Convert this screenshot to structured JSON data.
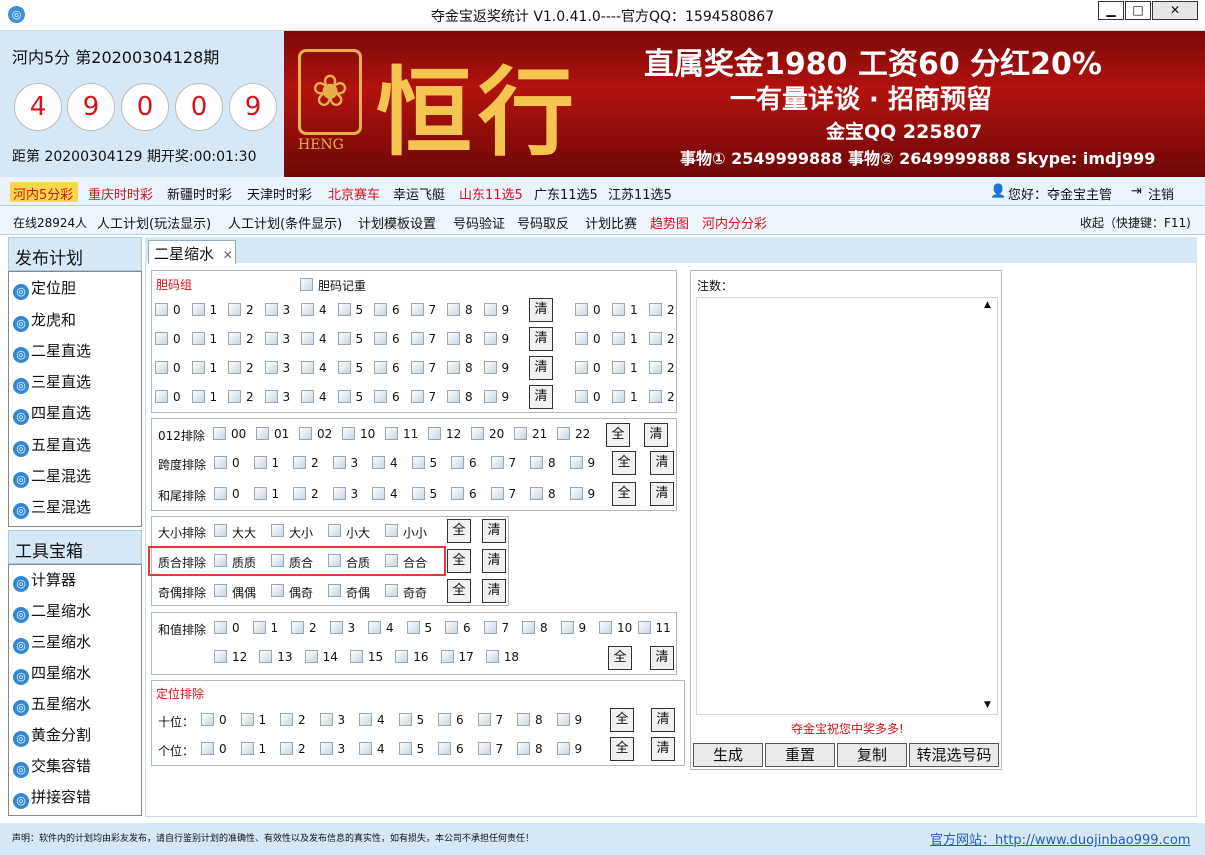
{
  "window": {
    "title": "夺金宝返奖统计  V1.0.41.0----官方QQ：1594580867"
  },
  "header": {
    "lottery_name": "河内5分  第20200304128期",
    "balls": [
      "4",
      "9",
      "0",
      "0",
      "9"
    ],
    "countdown": "距第 20200304129 期开奖:00:01:30"
  },
  "banner": {
    "logo_text": "HENG",
    "big_text": "恒行",
    "line1": "直属奖金1980 工资60 分红20%",
    "line2": "一有量详谈 · 招商预留",
    "line3": "金宝QQ 225807",
    "line4": "事物① 2549999888  事物② 2649999888  Skype: imdj999"
  },
  "lottery_nav": {
    "items": [
      {
        "label": "河内5分彩",
        "color": "#d8111a"
      },
      {
        "label": "重庆时时彩",
        "color": "#d8111a"
      },
      {
        "label": "新疆时时彩",
        "color": "#111111"
      },
      {
        "label": "天津时时彩",
        "color": "#111111"
      },
      {
        "label": "北京赛车",
        "color": "#d8111a"
      },
      {
        "label": "幸运飞艇",
        "color": "#111111"
      },
      {
        "label": "山东11选5",
        "color": "#d8111a"
      },
      {
        "label": "广东11选5",
        "color": "#111111"
      },
      {
        "label": "江苏11选5",
        "color": "#111111"
      }
    ],
    "user_greeting": "您好：夺金宝主管",
    "logout": "注销"
  },
  "tool_nav": {
    "online": "在线28924人",
    "items": [
      {
        "label": "人工计划(玩法显示)",
        "color": "#111111"
      },
      {
        "label": "人工计划(条件显示)",
        "color": "#111111"
      },
      {
        "label": "计划模板设置",
        "color": "#111111"
      },
      {
        "label": "号码验证",
        "color": "#111111"
      },
      {
        "label": "号码取反",
        "color": "#111111"
      },
      {
        "label": "计划比赛",
        "color": "#111111"
      },
      {
        "label": "趋势图",
        "color": "#d8111a"
      },
      {
        "label": "河内分分彩",
        "color": "#d8111a"
      }
    ],
    "collapse": "收起（快捷键：F11)"
  },
  "left_panel": {
    "group1_title": "发布计划",
    "group1_items": [
      "定位胆",
      "龙虎和",
      "二星直选",
      "三星直选",
      "四星直选",
      "五星直选",
      "二星混选",
      "三星混选"
    ],
    "group2_title": "工具宝箱",
    "group2_items": [
      "计算器",
      "二星缩水",
      "三星缩水",
      "四星缩水",
      "五星缩水",
      "黄金分割",
      "交集容错",
      "拼接容错"
    ]
  },
  "main": {
    "tab_label": "二星缩水",
    "tab_close": "✕",
    "dan_title": "胆码组",
    "dan_record": "胆码记重",
    "digits": [
      "0",
      "1",
      "2",
      "3",
      "4",
      "5",
      "6",
      "7",
      "8",
      "9"
    ],
    "digits_right": [
      "0",
      "1",
      "2"
    ],
    "clear": "清",
    "all": "全",
    "filter012": {
      "label": "012排除",
      "options": [
        "00",
        "01",
        "02",
        "10",
        "11",
        "12",
        "20",
        "21",
        "22"
      ]
    },
    "span": {
      "label": "跨度排除"
    },
    "tailsum": {
      "label": "和尾排除"
    },
    "bigsmall": {
      "label": "大小排除",
      "options": [
        "大大",
        "大小",
        "小大",
        "小小"
      ]
    },
    "primecomp": {
      "label": "质合排除",
      "options": [
        "质质",
        "质合",
        "合质",
        "合合"
      ]
    },
    "oddeven": {
      "label": "奇偶排除",
      "options": [
        "偶偶",
        "偶奇",
        "奇偶",
        "奇奇"
      ]
    },
    "sumvalue": {
      "label": "和值排除",
      "options": [
        "0",
        "1",
        "2",
        "3",
        "4",
        "5",
        "6",
        "7",
        "8",
        "9",
        "10",
        "11",
        "12",
        "13",
        "14",
        "15",
        "16",
        "17",
        "18"
      ]
    },
    "position": {
      "title": "定位排除",
      "tens": "十位：",
      "units": "个位："
    },
    "output": {
      "label": "注数：",
      "wish": "夺金宝祝您中奖多多!",
      "up_arrow": "▲",
      "down_arrow": "▼"
    },
    "actions": [
      "生成",
      "重置",
      "复制",
      "转混选号码"
    ]
  },
  "footer": {
    "disclaimer": "声明：软件内的计划均由彩友发布，请自行鉴别计划的准确性、有效性以及发布信息的真实性，如有损失，本公司不承担任何责任！",
    "website": "官方网站：http://www.duojinbao999.com"
  }
}
